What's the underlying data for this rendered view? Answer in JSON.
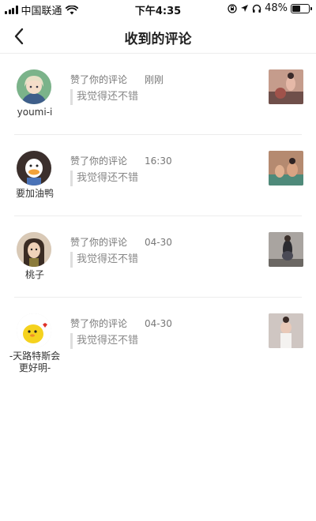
{
  "status_bar": {
    "carrier": "中国联通",
    "time": "下午4:35",
    "battery_percent_text": "48%",
    "battery_level": 0.48
  },
  "nav": {
    "title": "收到的评论",
    "back_icon": "chevron-left-icon"
  },
  "comments": [
    {
      "user": "youmi-i",
      "action": "赞了你的评论",
      "time": "刚刚",
      "quote": "我觉得还不错",
      "avatar_icon": "anime-girl-avatar",
      "thumb_icon": "workout-photo-thumbnail"
    },
    {
      "user": "要加油鸭",
      "action": "赞了你的评论",
      "time": "16:30",
      "quote": "我觉得还不错",
      "avatar_icon": "duck-avatar",
      "thumb_icon": "workout-photo-thumbnail"
    },
    {
      "user": "桃子",
      "action": "赞了你的评论",
      "time": "04-30",
      "quote": "我觉得还不错",
      "avatar_icon": "cartoon-girl-avatar",
      "thumb_icon": "workout-photo-thumbnail"
    },
    {
      "user": "-天路特斯会更好明-",
      "action": "赞了你的评论",
      "time": "04-30",
      "quote": "我觉得还不错",
      "avatar_icon": "yellow-chick-avatar",
      "thumb_icon": "workout-photo-thumbnail"
    }
  ]
}
